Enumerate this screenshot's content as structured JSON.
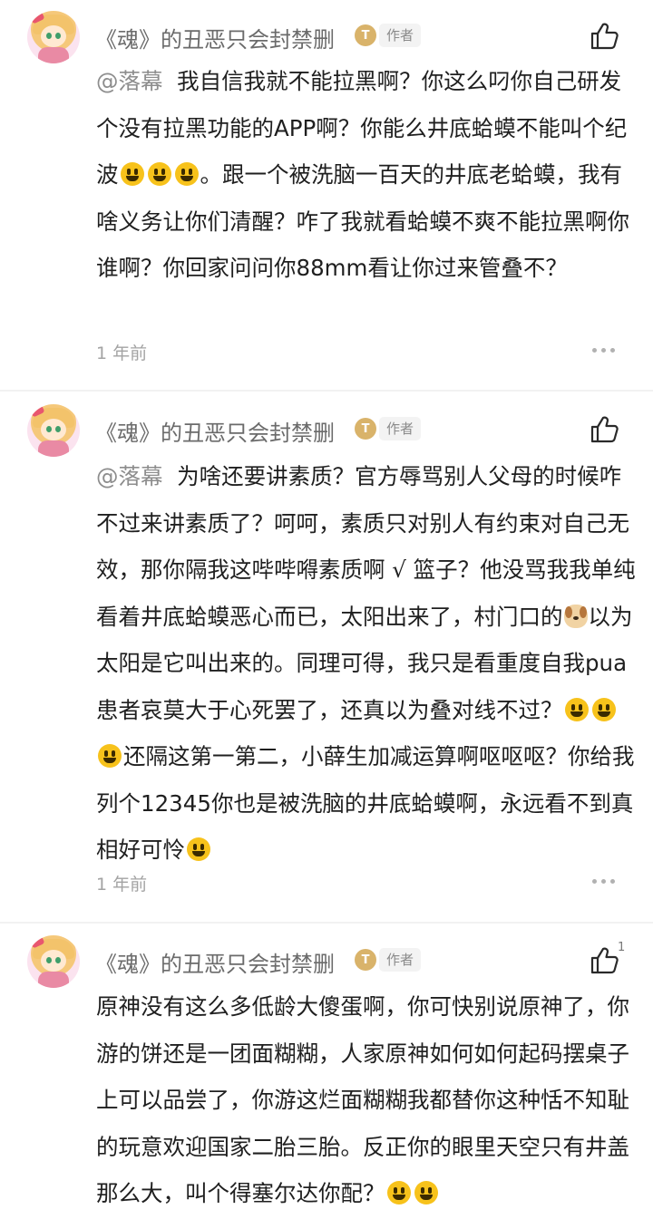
{
  "comments": [
    {
      "user": "《魂》的丑恶只会封禁删",
      "level": "T",
      "tag": "作者",
      "mention": "@落幕",
      "text_1": "我自信我就不能拉黑啊？你这么叼你自己研发个没有拉黑功能的APP啊？你能么井底蛤蟆不能叫个纪波",
      "text_2": "。跟一个被洗脑一百天的井底老蛤蟆，我有啥义务让你们清醒？咋了我就看蛤蟆不爽不能拉黑啊你谁啊？你回家问问你88mm看让你过来管叠不？",
      "time": "1 年前",
      "likes": ""
    },
    {
      "user": "《魂》的丑恶只会封禁删",
      "level": "T",
      "tag": "作者",
      "mention": "@落幕",
      "text_1": "为啥还要讲素质？官方辱骂别人父母的时候咋不过来讲素质了？呵呵，素质只对别人有约束对自己无效，那你隔我这哔哔嘚素质啊 √ 篮子？他没骂我我单纯看着井底蛤蟆恶心而已，太阳出来了，村门口的",
      "text_2": "以为太阳是它叫出来的。同理可得，我只是看重度自我pua患者哀莫大于心死罢了，还真以为叠对线不过？",
      "text_3": "还隔这第一第二，小薛生加减运算啊呕呕呕？你给我列个12345你也是被洗脑的井底蛤蟆啊，永远看不到真相好可怜",
      "time": "1 年前",
      "likes": ""
    },
    {
      "user": "《魂》的丑恶只会封禁删",
      "level": "T",
      "tag": "作者",
      "text_1": "原神没有这么多低龄大傻蛋啊，你可快别说原神了，你游的饼还是一团面糊糊，人家原神如何如何起码摆桌子上可以品尝了，你游这烂面糊糊我都替你这种恬不知耻的玩意欢迎国家二胎三胎。反正你的眼里天空只有井盖那么大，叫个得塞尔达你配？",
      "likes": "1"
    }
  ],
  "icons": {
    "like": "thumbs-up-icon",
    "more": "more-dots-icon",
    "smile": "smiley-emoji",
    "dog": "dog-emoji",
    "grin": "grin-emoji"
  },
  "colors": {
    "name": "#6b6b6b",
    "level_badge": "#d9b36a",
    "mention": "#8d8d8d",
    "time": "#a3a3a3"
  }
}
